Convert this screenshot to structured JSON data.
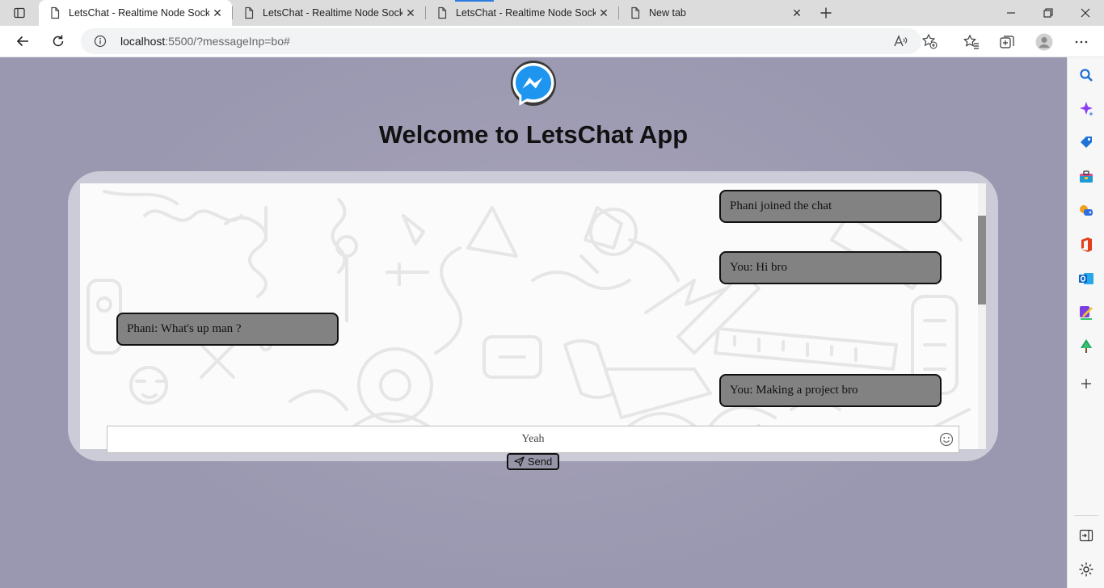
{
  "browser": {
    "tabs": [
      {
        "title": "LetsChat - Realtime Node Socket",
        "active": true
      },
      {
        "title": "LetsChat - Realtime Node Socket",
        "active": false
      },
      {
        "title": "LetsChat - Realtime Node Socket",
        "active": false
      },
      {
        "title": "New tab",
        "active": false
      }
    ],
    "url_host": "localhost",
    "url_rest": ":5500/?messageInp=bo#"
  },
  "app": {
    "title": "Welcome to LetsChat App",
    "messages": [
      {
        "text": "Phani joined the chat",
        "side": "right"
      },
      {
        "text": "You: Hi bro",
        "side": "right"
      },
      {
        "text": "Phani: What's up man ?",
        "side": "left"
      },
      {
        "text": "You: Making a project bro",
        "side": "right"
      }
    ],
    "input_value": "Yeah",
    "send_label": "Send"
  },
  "colors": {
    "page_background": "#9f9db4",
    "chat_shell": "#ccccd9",
    "message_bubble": "#828282",
    "messenger_blue": "#1e96f0"
  },
  "icons": [
    "tab-actions-icon",
    "page-icon",
    "close-icon",
    "plus-icon",
    "minimize-icon",
    "restore-icon",
    "back-icon",
    "refresh-icon",
    "info-icon",
    "read-aloud-icon",
    "add-favorite-icon",
    "favorites-icon",
    "collections-icon",
    "profile-icon",
    "more-icon",
    "search-icon",
    "copilot-icon",
    "shopping-icon",
    "tools-icon",
    "games-icon",
    "office-icon",
    "outlook-icon",
    "designer-icon",
    "tree-icon",
    "expand-sidebar-icon",
    "settings-icon",
    "messenger-logo-icon",
    "emoji-icon",
    "send-icon"
  ]
}
